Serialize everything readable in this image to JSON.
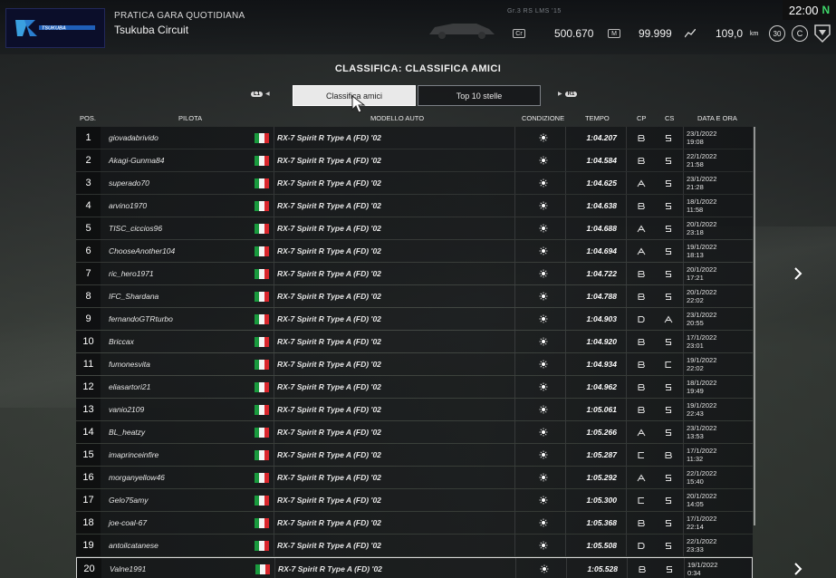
{
  "header": {
    "event_type": "PRATICA GARA QUOTIDIANA",
    "track": "Tsukuba Circuit",
    "car_meta": "Gr.3    RS LMS '15",
    "credits": "500.670",
    "mileage_points": "99.999",
    "distance": "109,0",
    "distance_unit": "km",
    "level": "30",
    "clock": "22:00",
    "network_icon": "N"
  },
  "page": {
    "title": "CLASSIFICA: CLASSIFICA AMICI",
    "tab_left_hint": "L1",
    "tab_right_hint": "R1",
    "tabs": [
      {
        "label": "Classifica amici",
        "active": true
      },
      {
        "label": "Top 10 stelle",
        "active": false
      }
    ]
  },
  "table": {
    "columns": {
      "pos": "POS.",
      "pilot": "PILOTA",
      "car": "MODELLO AUTO",
      "condition": "CONDIZIONE",
      "time": "TEMPO",
      "cp": "CP",
      "cs": "CS",
      "date": "DATA E ORA"
    },
    "rows": [
      {
        "pos": "1",
        "pilot": "giovadabrivido",
        "car": "RX-7 Spirit R Type A (FD) '02",
        "time": "1:04.207",
        "cp": "B",
        "cs": "S",
        "date": "23/1/2022",
        "hour": "19:08"
      },
      {
        "pos": "2",
        "pilot": "Akagi-Gunma84",
        "car": "RX-7 Spirit R Type A (FD) '02",
        "time": "1:04.584",
        "cp": "B",
        "cs": "S",
        "date": "22/1/2022",
        "hour": "21:58"
      },
      {
        "pos": "3",
        "pilot": "superado70",
        "car": "RX-7 Spirit R Type A (FD) '02",
        "time": "1:04.625",
        "cp": "A",
        "cs": "S",
        "date": "23/1/2022",
        "hour": "21:28"
      },
      {
        "pos": "4",
        "pilot": "arvino1970",
        "car": "RX-7 Spirit R Type A (FD) '02",
        "time": "1:04.638",
        "cp": "B",
        "cs": "S",
        "date": "18/1/2022",
        "hour": "11:58"
      },
      {
        "pos": "5",
        "pilot": "TISC_ciccios96",
        "car": "RX-7 Spirit R Type A (FD) '02",
        "time": "1:04.688",
        "cp": "A",
        "cs": "S",
        "date": "20/1/2022",
        "hour": "23:18"
      },
      {
        "pos": "6",
        "pilot": "ChooseAnother104",
        "car": "RX-7 Spirit R Type A (FD) '02",
        "time": "1:04.694",
        "cp": "A",
        "cs": "S",
        "date": "19/1/2022",
        "hour": "18:13"
      },
      {
        "pos": "7",
        "pilot": "ric_hero1971",
        "car": "RX-7 Spirit R Type A (FD) '02",
        "time": "1:04.722",
        "cp": "B",
        "cs": "S",
        "date": "20/1/2022",
        "hour": "17:21"
      },
      {
        "pos": "8",
        "pilot": "IFC_Shardana",
        "car": "RX-7 Spirit R Type A (FD) '02",
        "time": "1:04.788",
        "cp": "B",
        "cs": "S",
        "date": "20/1/2022",
        "hour": "22:02"
      },
      {
        "pos": "9",
        "pilot": "fernandoGTRturbo",
        "car": "RX-7 Spirit R Type A (FD) '02",
        "time": "1:04.903",
        "cp": "D",
        "cs": "A",
        "date": "23/1/2022",
        "hour": "20:55"
      },
      {
        "pos": "10",
        "pilot": "Briccax",
        "car": "RX-7 Spirit R Type A (FD) '02",
        "time": "1:04.920",
        "cp": "B",
        "cs": "S",
        "date": "17/1/2022",
        "hour": "23:01"
      },
      {
        "pos": "11",
        "pilot": "fumonesvita",
        "car": "RX-7 Spirit R Type A (FD) '02",
        "time": "1:04.934",
        "cp": "B",
        "cs": "C",
        "date": "19/1/2022",
        "hour": "22:02"
      },
      {
        "pos": "12",
        "pilot": "eliasartori21",
        "car": "RX-7 Spirit R Type A (FD) '02",
        "time": "1:04.962",
        "cp": "B",
        "cs": "S",
        "date": "18/1/2022",
        "hour": "19:49"
      },
      {
        "pos": "13",
        "pilot": "vanio2109",
        "car": "RX-7 Spirit R Type A (FD) '02",
        "time": "1:05.061",
        "cp": "B",
        "cs": "S",
        "date": "19/1/2022",
        "hour": "22:43"
      },
      {
        "pos": "14",
        "pilot": "BL_heatzy",
        "car": "RX-7 Spirit R Type A (FD) '02",
        "time": "1:05.266",
        "cp": "A",
        "cs": "S",
        "date": "23/1/2022",
        "hour": "13:53"
      },
      {
        "pos": "15",
        "pilot": "imaprinceinfire",
        "car": "RX-7 Spirit R Type A (FD) '02",
        "time": "1:05.287",
        "cp": "C",
        "cs": "B",
        "date": "17/1/2022",
        "hour": "11:32"
      },
      {
        "pos": "16",
        "pilot": "morganyellow46",
        "car": "RX-7 Spirit R Type A (FD) '02",
        "time": "1:05.292",
        "cp": "A",
        "cs": "S",
        "date": "22/1/2022",
        "hour": "15:40"
      },
      {
        "pos": "17",
        "pilot": "Gelo75amy",
        "car": "RX-7 Spirit R Type A (FD) '02",
        "time": "1:05.300",
        "cp": "C",
        "cs": "S",
        "date": "20/1/2022",
        "hour": "14:05"
      },
      {
        "pos": "18",
        "pilot": "joe-coal-67",
        "car": "RX-7 Spirit R Type A (FD) '02",
        "time": "1:05.368",
        "cp": "B",
        "cs": "S",
        "date": "17/1/2022",
        "hour": "22:14"
      },
      {
        "pos": "19",
        "pilot": "antoilcatanese",
        "car": "RX-7 Spirit R Type A (FD) '02",
        "time": "1:05.508",
        "cp": "D",
        "cs": "S",
        "date": "22/1/2022",
        "hour": "23:33"
      },
      {
        "pos": "20",
        "pilot": "Valne1991",
        "car": "RX-7 Spirit R Type A (FD) '02",
        "time": "1:05.528",
        "cp": "B",
        "cs": "S",
        "date": "19/1/2022",
        "hour": "0:34"
      }
    ]
  },
  "colors": {
    "row_bg": "#16181a",
    "flag_green": "#1a9a3e",
    "flag_white": "#f4f4f4",
    "flag_red": "#d9262c",
    "active_tab_bg": "#e9e9e9"
  },
  "icons": {
    "condition": "sun-icon",
    "next_page": "chevron-right-icon",
    "cursor": "cursor-pointer-icon"
  }
}
